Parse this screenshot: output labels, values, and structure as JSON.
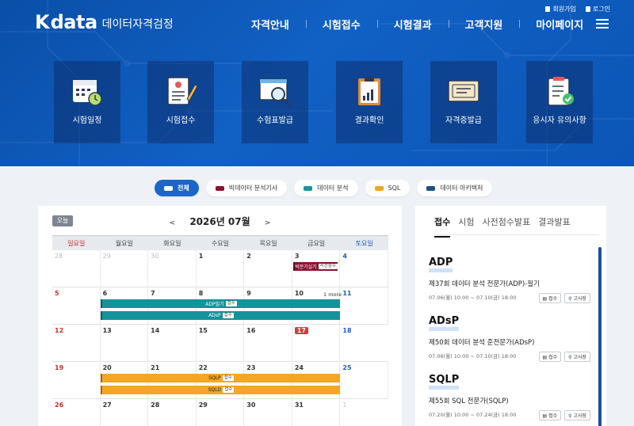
{
  "header": {
    "logo_k": "K",
    "logo_data": "data",
    "logo_sub": "데이터자격검정",
    "util_links": [
      "회원가입",
      "로그인"
    ],
    "nav": [
      "자격안내",
      "시험접수",
      "시험결과",
      "고객지원",
      "마이페이지"
    ]
  },
  "quick_cards": [
    {
      "label": "시험일정",
      "icon": "calendar-clock-icon"
    },
    {
      "label": "시험접수",
      "icon": "document-pen-icon"
    },
    {
      "label": "수험표발급",
      "icon": "browser-search-icon"
    },
    {
      "label": "결과확인",
      "icon": "clipboard-chart-icon"
    },
    {
      "label": "자격증발급",
      "icon": "certificate-icon"
    },
    {
      "label": "응시자 유의사항",
      "icon": "checklist-icon"
    }
  ],
  "filters": [
    {
      "label": "전체",
      "color": "#1a66c9",
      "active": true
    },
    {
      "label": "빅데이터 분석기사",
      "color": "#8a1330"
    },
    {
      "label": "데이터 분석",
      "color": "#14939a"
    },
    {
      "label": "SQL",
      "color": "#f5a623"
    },
    {
      "label": "데이터 아키텍처",
      "color": "#1e4f8c"
    }
  ],
  "calendar": {
    "today_label": "오늘",
    "prev": "<",
    "next": ">",
    "title": "2026년 07월",
    "weekdays": [
      "일요일",
      "월요일",
      "화요일",
      "수요일",
      "목요일",
      "금요일",
      "토요일"
    ],
    "weeks": [
      [
        "28",
        "29",
        "30",
        "1",
        "2",
        "3",
        "4"
      ],
      [
        "5",
        "6",
        "7",
        "8",
        "9",
        "10",
        "11"
      ],
      [
        "12",
        "13",
        "14",
        "15",
        "16",
        "17",
        "18"
      ],
      [
        "19",
        "20",
        "21",
        "22",
        "23",
        "24",
        "25"
      ],
      [
        "26",
        "27",
        "28",
        "29",
        "30",
        "31",
        "1"
      ]
    ],
    "highlight_day": "17",
    "more_label": "1 more",
    "events": [
      {
        "title": "빅분기실기",
        "tag": "사전점수",
        "color": "#8a1330"
      },
      {
        "title": "ADP필기",
        "tag": "접수",
        "color": "#14939a"
      },
      {
        "title": "ADsP",
        "tag": "접수",
        "color": "#14939a"
      },
      {
        "title": "SQLP",
        "tag": "접수",
        "color": "#f5a623"
      },
      {
        "title": "SQLD",
        "tag": "접수",
        "color": "#f5a623"
      }
    ]
  },
  "side": {
    "tabs": [
      "접수",
      "시험",
      "사전점수발표",
      "결과발표"
    ],
    "exams": [
      {
        "code": "ADP",
        "name": "제37회 데이터 분석 전문가(ADP)-필기",
        "date": "07.06(월) 10:00 ~ 07.10(금) 18:00",
        "btn1": "접수",
        "btn2": "고사장"
      },
      {
        "code": "ADsP",
        "name": "제50회 데이터 분석 준전문가(ADsP)",
        "date": "07.06(월) 10:00 ~ 07.10(금) 18:00",
        "btn1": "접수",
        "btn2": "고사장"
      },
      {
        "code": "SQLP",
        "name": "제55회 SQL 전문가(SQLP)",
        "date": "07.20(월) 10:00 ~ 07.24(금) 18:00",
        "btn1": "접수",
        "btn2": "고사장"
      }
    ]
  }
}
